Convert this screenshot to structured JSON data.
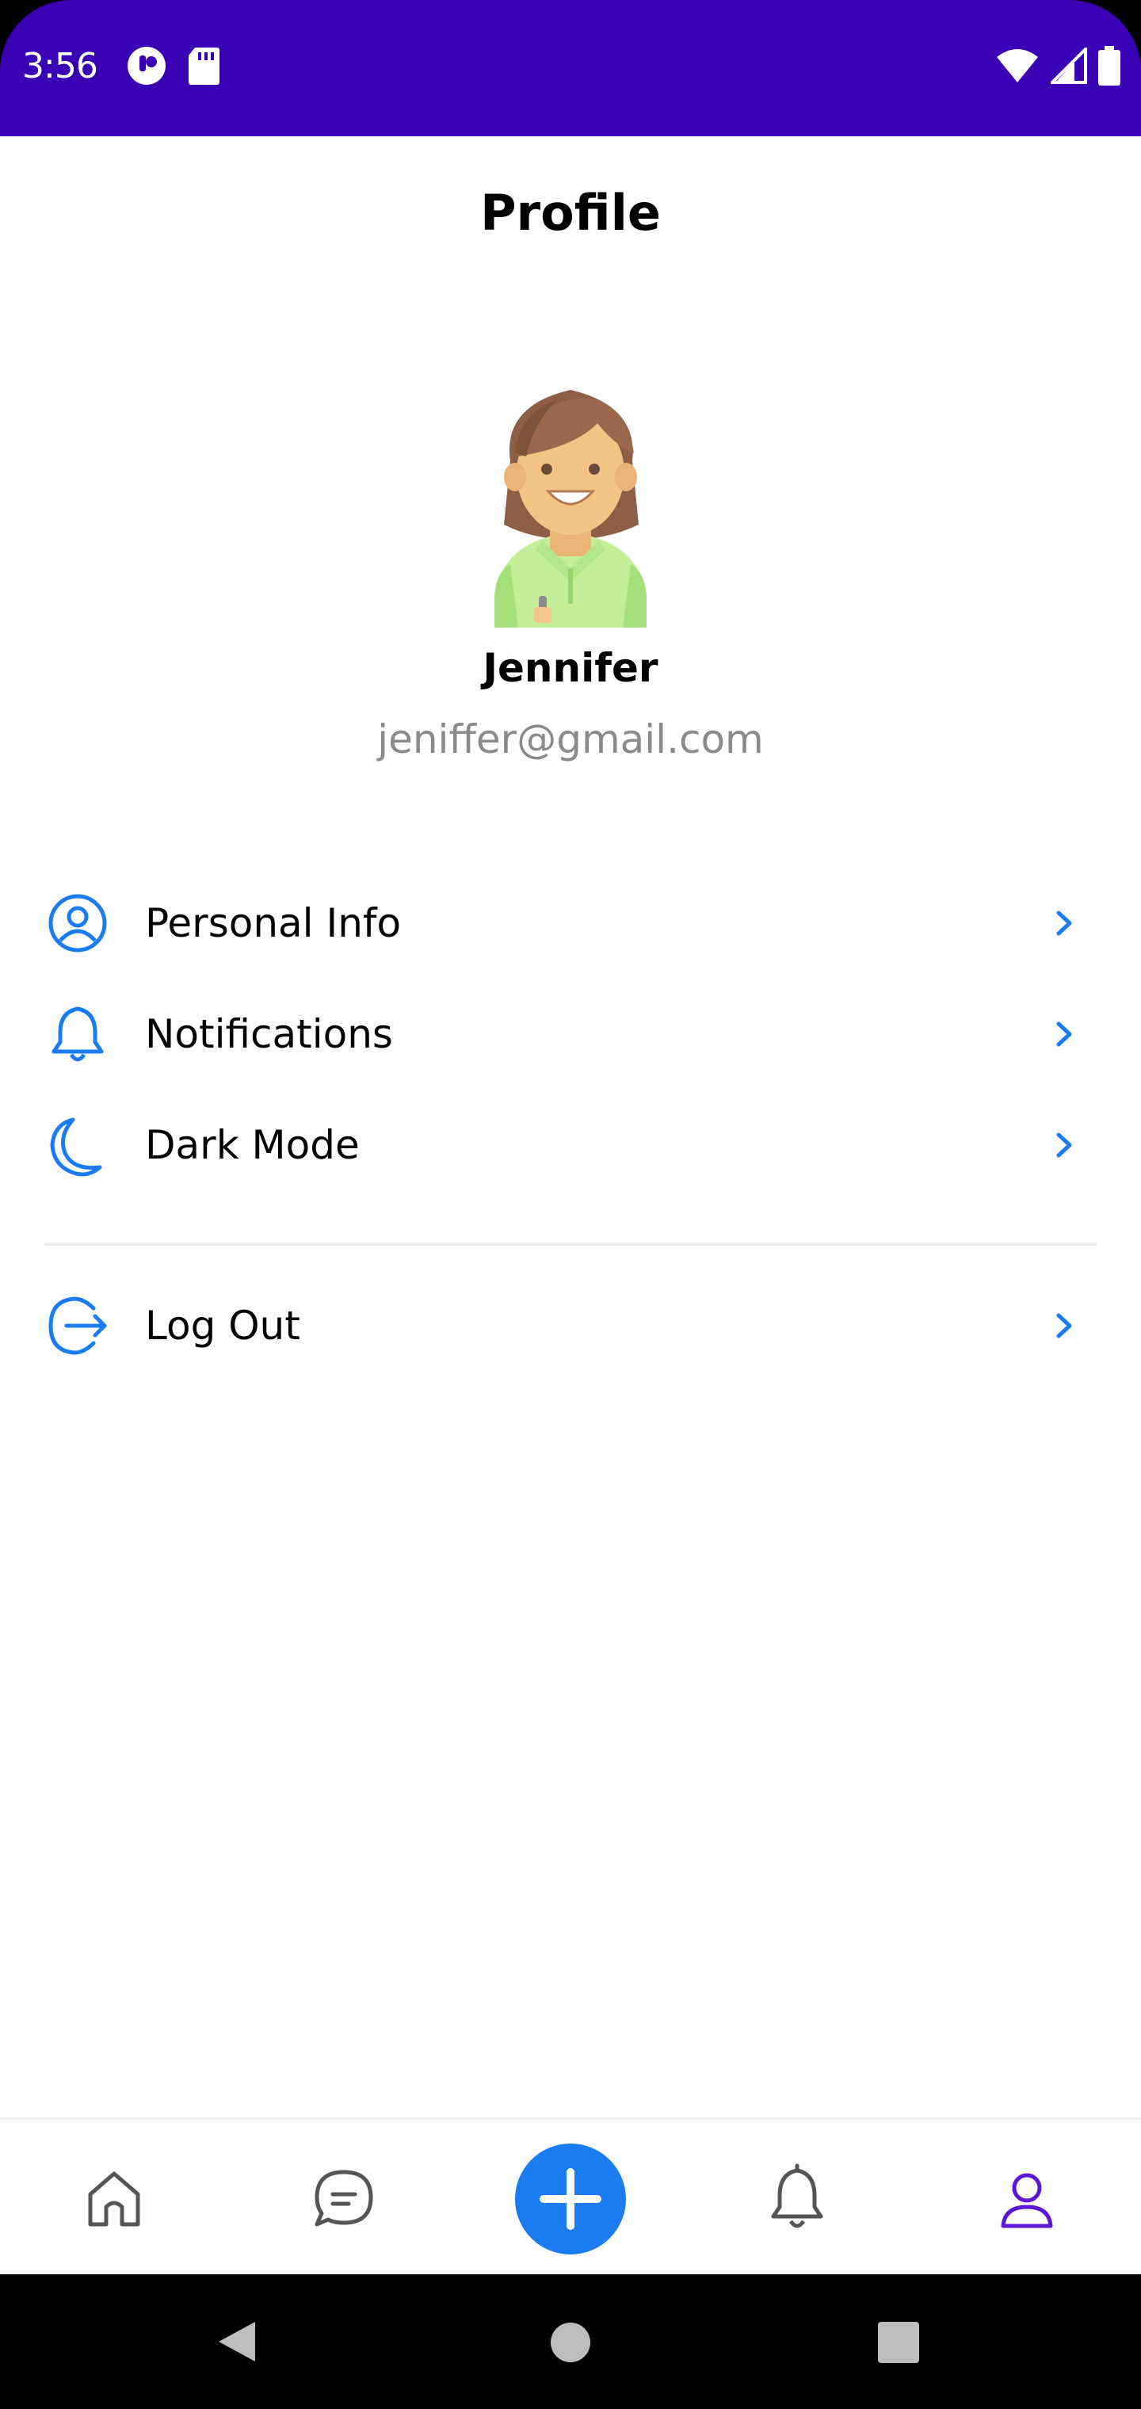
{
  "status_bar": {
    "time": "3:56"
  },
  "header": {
    "title": "Profile"
  },
  "profile": {
    "name": "Jennifer",
    "email": "jeniffer@gmail.com"
  },
  "menu": {
    "items": [
      {
        "label": "Personal Info",
        "icon": "user-circle-icon"
      },
      {
        "label": "Notifications",
        "icon": "bell-icon"
      },
      {
        "label": "Dark Mode",
        "icon": "moon-icon"
      }
    ],
    "logout": {
      "label": "Log Out",
      "icon": "logout-icon"
    }
  },
  "bottom_nav": {
    "items": [
      "home-icon",
      "chat-icon",
      "add-icon",
      "bell-icon",
      "profile-icon"
    ],
    "active": "profile-icon"
  },
  "colors": {
    "status_bar": "#3a00b4",
    "accent": "#1a7cf0",
    "active_nav": "#5b16d6",
    "inactive_nav": "#555555",
    "email_gray": "#8a8a8a"
  }
}
